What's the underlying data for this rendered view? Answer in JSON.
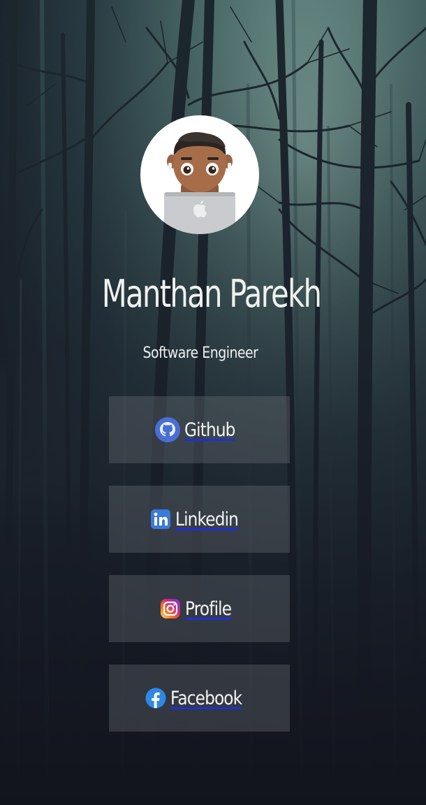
{
  "profile": {
    "name": "Manthan Parekh",
    "title": "Software Engineer"
  },
  "links": [
    {
      "label": "Github",
      "icon": "github-icon",
      "color": "#4a6fd4"
    },
    {
      "label": "Linkedin",
      "icon": "linkedin-icon",
      "color": "#3a7ad8"
    },
    {
      "label": "Profile",
      "icon": "instagram-icon",
      "color": "#e1306c"
    },
    {
      "label": "Facebook",
      "icon": "facebook-icon",
      "color": "#2d88e8"
    }
  ],
  "colors": {
    "card_background": "rgba(110,116,124,0.34)",
    "link_underline": "#1f2fd6",
    "text": "#f2f4f4"
  }
}
